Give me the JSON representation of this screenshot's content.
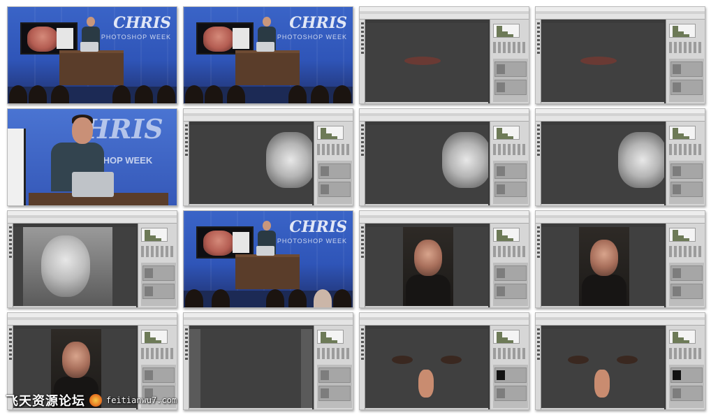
{
  "grid": {
    "columns": 4,
    "rows": 4,
    "frames": [
      {
        "id": 1,
        "scene": "studio-wide"
      },
      {
        "id": 2,
        "scene": "studio-wide"
      },
      {
        "id": 3,
        "scene": "photoshop-mouth"
      },
      {
        "id": 4,
        "scene": "photoshop-mouth"
      },
      {
        "id": 5,
        "scene": "studio-closeup"
      },
      {
        "id": 6,
        "scene": "photoshop-gray"
      },
      {
        "id": 7,
        "scene": "photoshop-gray"
      },
      {
        "id": 8,
        "scene": "photoshop-gray"
      },
      {
        "id": 9,
        "scene": "photoshop-portrait-bw"
      },
      {
        "id": 10,
        "scene": "studio-wide"
      },
      {
        "id": 11,
        "scene": "photoshop-portrait-color"
      },
      {
        "id": 12,
        "scene": "photoshop-portrait-color"
      },
      {
        "id": 13,
        "scene": "photoshop-portrait-color"
      },
      {
        "id": 14,
        "scene": "photoshop-flat-gray"
      },
      {
        "id": 15,
        "scene": "photoshop-eyes"
      },
      {
        "id": 16,
        "scene": "photoshop-eyes"
      }
    ]
  },
  "studio": {
    "brand": "CHRIS",
    "brand_sub": "PHOTOSHOP WEEK",
    "closeup_brand": "HRIS",
    "closeup_sub": "SHOP WEEK"
  },
  "colors": {
    "studio_blue": "#3a64c7",
    "photoshop_ui": "#d6d6d6",
    "canvas_bg": "#3b3b3b"
  },
  "watermark": {
    "cn": "飞天资源论坛",
    "en": "feitianwu7.com",
    "icon": "flame-logo-icon"
  }
}
